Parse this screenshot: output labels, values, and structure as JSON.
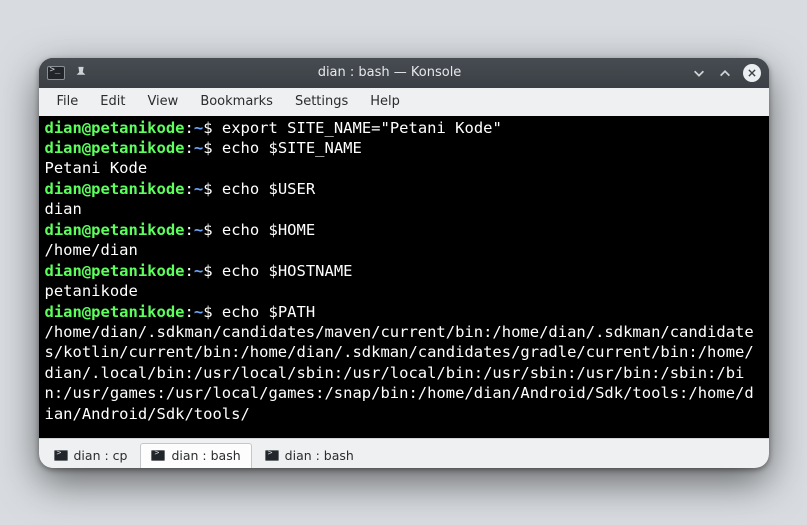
{
  "titlebar": {
    "title": "dian : bash — Konsole"
  },
  "menu": {
    "file": "File",
    "edit": "Edit",
    "view": "View",
    "bookmarks": "Bookmarks",
    "settings": "Settings",
    "help": "Help"
  },
  "prompt": {
    "user": "dian",
    "host": "petanikode",
    "cwd": "~"
  },
  "lines": [
    {
      "type": "cmd",
      "text": "export SITE_NAME=\"Petani Kode\""
    },
    {
      "type": "cmd",
      "text": "echo $SITE_NAME"
    },
    {
      "type": "out",
      "text": "Petani Kode"
    },
    {
      "type": "cmd",
      "text": "echo $USER"
    },
    {
      "type": "out",
      "text": "dian"
    },
    {
      "type": "cmd",
      "text": "echo $HOME"
    },
    {
      "type": "out",
      "text": "/home/dian"
    },
    {
      "type": "cmd",
      "text": "echo $HOSTNAME"
    },
    {
      "type": "out",
      "text": "petanikode"
    },
    {
      "type": "cmd",
      "text": "echo $PATH"
    },
    {
      "type": "out",
      "text": "/home/dian/.sdkman/candidates/maven/current/bin:/home/dian/.sdkman/candidates/kotlin/current/bin:/home/dian/.sdkman/candidates/gradle/current/bin:/home/dian/.local/bin:/usr/local/sbin:/usr/local/bin:/usr/sbin:/usr/bin:/sbin:/bin:/usr/games:/usr/local/games:/snap/bin:/home/dian/Android/Sdk/tools:/home/dian/Android/Sdk/tools/"
    }
  ],
  "tabs": [
    {
      "label": "dian : cp",
      "active": false
    },
    {
      "label": "dian : bash",
      "active": true
    },
    {
      "label": "dian : bash",
      "active": false
    }
  ]
}
